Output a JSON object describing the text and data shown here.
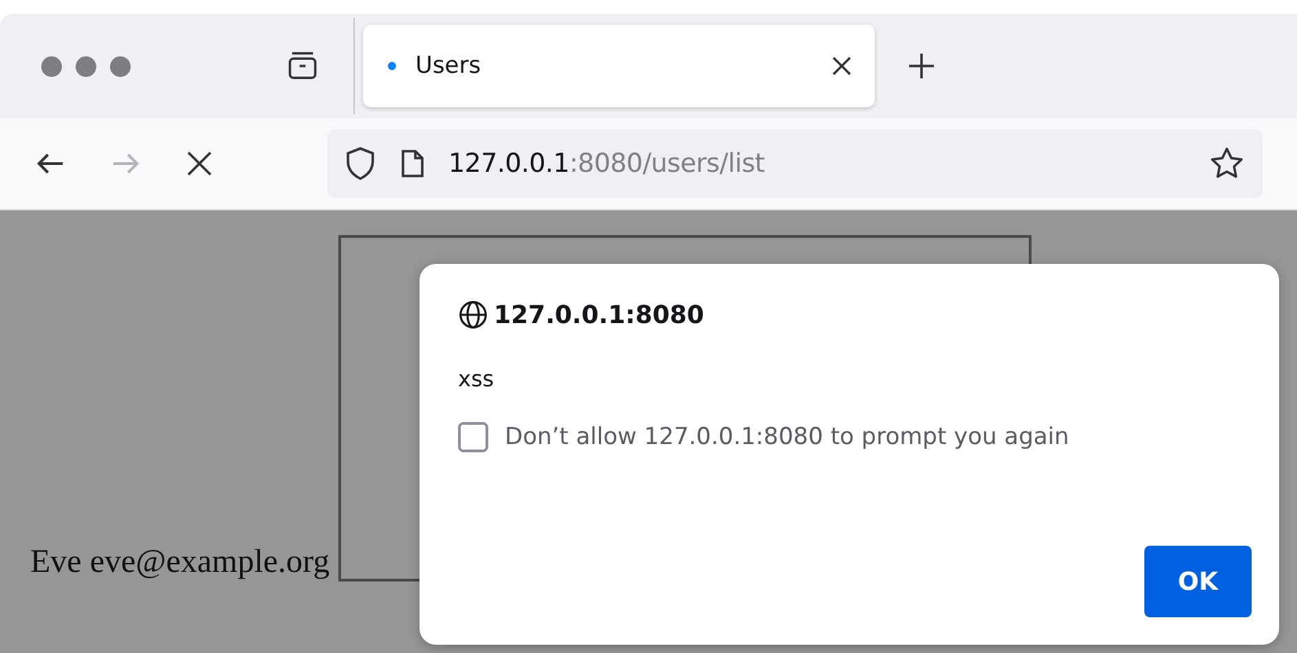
{
  "tabs": [
    {
      "label": "Users",
      "selected": true,
      "loading": true
    }
  ],
  "nav": {
    "back_disabled": false,
    "forward_disabled": true
  },
  "address": {
    "host": "127.0.0.1",
    "rest": ":8080/users/list"
  },
  "page": {
    "text": "Eve eve@example.org"
  },
  "dialog": {
    "origin": "127.0.0.1:8080",
    "message": "xss",
    "checkbox": {
      "label": "Don’t allow 127.0.0.1:8080 to prompt you again",
      "checked": false
    },
    "button": "OK"
  }
}
